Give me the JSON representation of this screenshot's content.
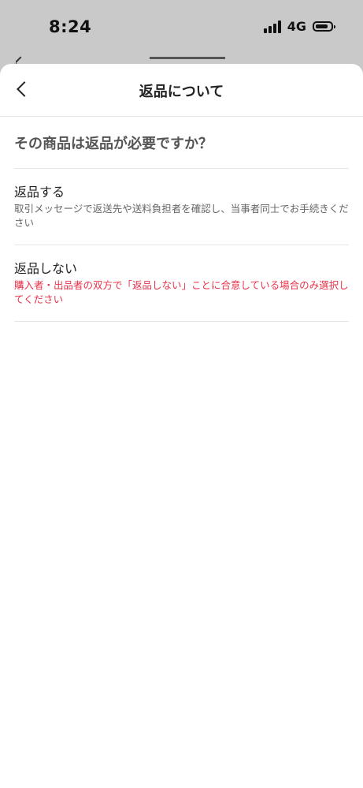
{
  "status_bar": {
    "time": "8:24",
    "network": "4G"
  },
  "header": {
    "title": "返品について"
  },
  "question": "その商品は返品が必要ですか？",
  "options": [
    {
      "title": "返品する",
      "description": "取引メッセージで返送先や送料負担者を確認し、当事者同士でお手続きください"
    },
    {
      "title": "返品しない",
      "description": "購入者・出品者の双方で「返品しない」ことに合意している場合のみ選択してください"
    }
  ],
  "colors": {
    "warning_text": "#e8324a",
    "status_bar_bg": "#c9c9c9"
  }
}
